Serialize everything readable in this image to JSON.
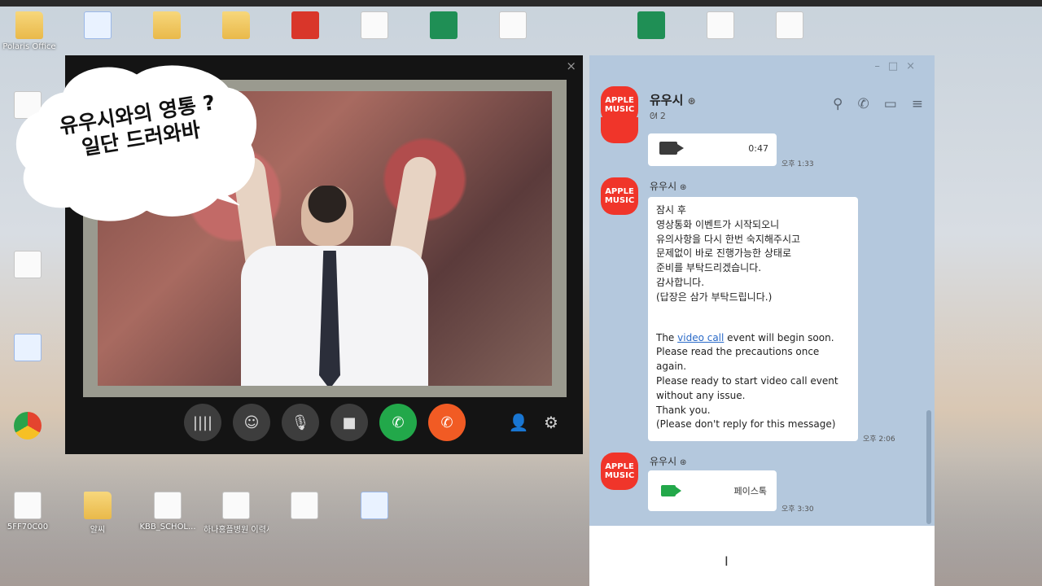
{
  "desktop": {
    "icons_top": [
      {
        "label": "Polaris Office",
        "kind": "folder"
      },
      {
        "label": "",
        "kind": "bluedoc"
      },
      {
        "label": "",
        "kind": "folder"
      },
      {
        "label": "",
        "kind": "folder"
      },
      {
        "label": "",
        "kind": "pdf"
      },
      {
        "label": "",
        "kind": "doc"
      },
      {
        "label": "",
        "kind": "sheet"
      },
      {
        "label": "",
        "kind": "doc"
      },
      {
        "label": "",
        "kind": "sheet"
      },
      {
        "label": "",
        "kind": "doc"
      },
      {
        "label": "",
        "kind": "doc"
      }
    ],
    "icons_left": [
      {
        "label": "",
        "kind": "doc"
      },
      {
        "label": "",
        "kind": "doc"
      },
      {
        "label": "",
        "kind": "bluedoc"
      },
      {
        "label": "",
        "kind": "chrome"
      }
    ],
    "icons_bottom": [
      {
        "label": "5FF70C00",
        "kind": "doc"
      },
      {
        "label": "알씨",
        "kind": "folder"
      },
      {
        "label": "KBB_SCHOL...",
        "kind": "doc"
      },
      {
        "label": "하나홍플병원 이력서",
        "kind": "doc"
      },
      {
        "label": "",
        "kind": "doc"
      },
      {
        "label": "",
        "kind": "bluedoc"
      }
    ]
  },
  "bubble": {
    "line1": "유우시와의 영통 ?",
    "line2": "일단 드러와바"
  },
  "video_call": {
    "close_glyph": "×",
    "controls": [
      {
        "name": "voice-button",
        "glyph": "||||",
        "style": "dark"
      },
      {
        "name": "effects-button",
        "glyph": "☺",
        "style": "dark"
      },
      {
        "name": "microphone-button",
        "glyph": "🎙",
        "style": "dark"
      },
      {
        "name": "camera-button",
        "glyph": "■",
        "style": "dark"
      },
      {
        "name": "accept-call-button",
        "glyph": "✆",
        "style": "green"
      },
      {
        "name": "end-call-button",
        "glyph": "✆",
        "style": "orange"
      },
      {
        "name": "participants-button",
        "glyph": "👤",
        "style": "plain"
      },
      {
        "name": "settings-button",
        "glyph": "⚙",
        "style": "plain"
      }
    ]
  },
  "chat": {
    "window_controls": "–□×",
    "avatar_text": "APPLE MUSIC",
    "title": "유우시",
    "member_count": "2",
    "messages": [
      {
        "kind": "video",
        "duration": "0:47",
        "time": "오후 1:33"
      },
      {
        "kind": "text",
        "sender": "유우시",
        "korean": "잠시 후\n영상통화 이벤트가 시작되오니\n유의사항을 다시 한번 숙지해주시고\n문제없이 바로 진행가능한 상태로\n준비를 부탁드리겠습니다.\n감사합니다.\n(답장은 삼가 부탁드립니다.)",
        "en_prefix": "The ",
        "en_link": "video call",
        "en_rest": " event will begin soon.\nPlease read the precautions once again.\nPlease ready to start video call event without any issue.\nThank you.\n(Please don't reply for this message)",
        "time": "오후 2:06"
      },
      {
        "kind": "facetalk",
        "sender": "유우시",
        "label": "페이스톡",
        "time": "오후 3:30"
      }
    ],
    "input_cursor": "I"
  }
}
